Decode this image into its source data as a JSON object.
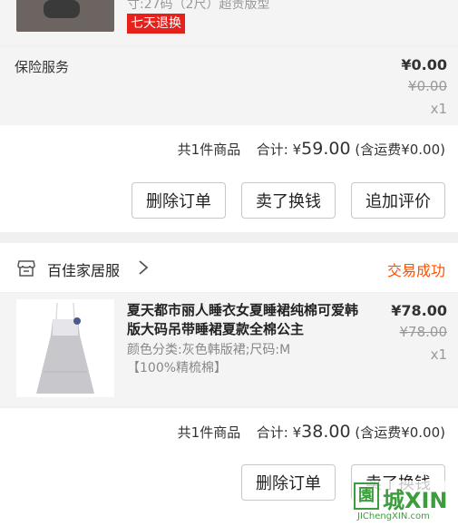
{
  "top_item": {
    "spec_text": "寸:27码（2尺）超贵版型",
    "return_tag": "七天退换"
  },
  "insurance": {
    "label": "保险服务",
    "price": "¥0.00",
    "original_price": "¥0.00",
    "qty": "x1"
  },
  "order1": {
    "count": "共1件商品",
    "total_label": "合计:",
    "currency": "¥",
    "total_value": "59.00",
    "shipping": "(含运费¥0.00)",
    "buttons": [
      "删除订单",
      "卖了换钱",
      "追加评价"
    ]
  },
  "order2": {
    "shop_name": "百佳家居服",
    "status": "交易成功",
    "title": "夏天都市丽人睡衣女夏睡裙纯棉可爱韩版大码吊带睡裙夏款全棉公主",
    "sku": "颜色分类:灰色韩版裙;尺码:M【100%精梳棉】",
    "price": "¥78.00",
    "original_price": "¥78.00",
    "qty": "x1",
    "count": "共1件商品",
    "total_label": "合计:",
    "currency": "¥",
    "total_value": "38.00",
    "shipping": "(含运费¥0.00)",
    "buttons": [
      "删除订单",
      "卖了换钱"
    ]
  },
  "watermark": {
    "text": "城XIN",
    "sub": "JIChengXIN.com"
  },
  "colors": {
    "accent_orange": "#ff5000",
    "tag_red": "#e5211c",
    "watermark_green": "#3c9d3c"
  }
}
